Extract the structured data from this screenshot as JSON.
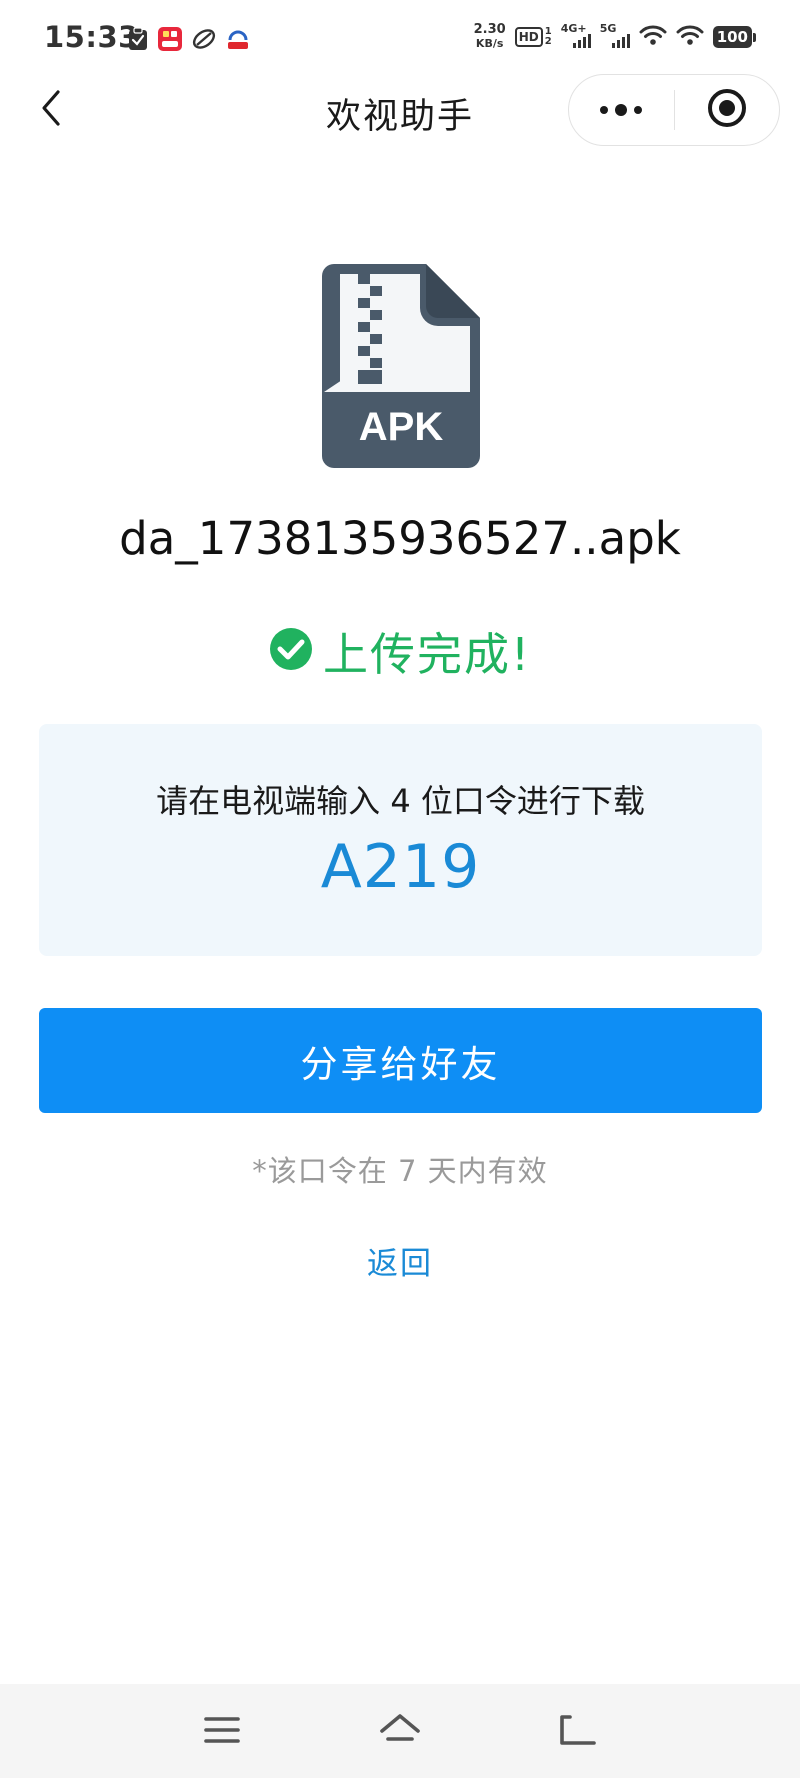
{
  "status_bar": {
    "time": "15:33",
    "net_speed_value": "2.30",
    "net_speed_unit": "KB/s",
    "hd_label": "HD",
    "hd_sim_top": "1",
    "hd_sim_bottom": "2",
    "signal1_label": "4G+",
    "signal2_label": "5G",
    "battery": "100",
    "left_icons": [
      "check-clipboard-icon",
      "shopping-app-icon",
      "leaf-app-icon",
      "bank-app-icon"
    ]
  },
  "nav": {
    "title": "欢视助手",
    "back_icon": "chevron-left-icon",
    "more_icon": "more-dots-icon",
    "close_icon": "target-close-icon"
  },
  "file": {
    "icon_label": "APK",
    "name": "da_1738135936527..apk"
  },
  "upload": {
    "status_text": "上传完成!",
    "status_color": "#20b25f"
  },
  "code_card": {
    "instruction": "请在电视端输入 4 位口令进行下载",
    "code": "A219",
    "code_color": "#1a8ad6"
  },
  "share_button": {
    "label": "分享给好友",
    "color": "#0e8ef5"
  },
  "validity_note": "*该口令在 7 天内有效",
  "back_link": "返回",
  "system_nav": {
    "icons": [
      "menu-icon",
      "home-icon",
      "back-arrow-icon"
    ]
  }
}
